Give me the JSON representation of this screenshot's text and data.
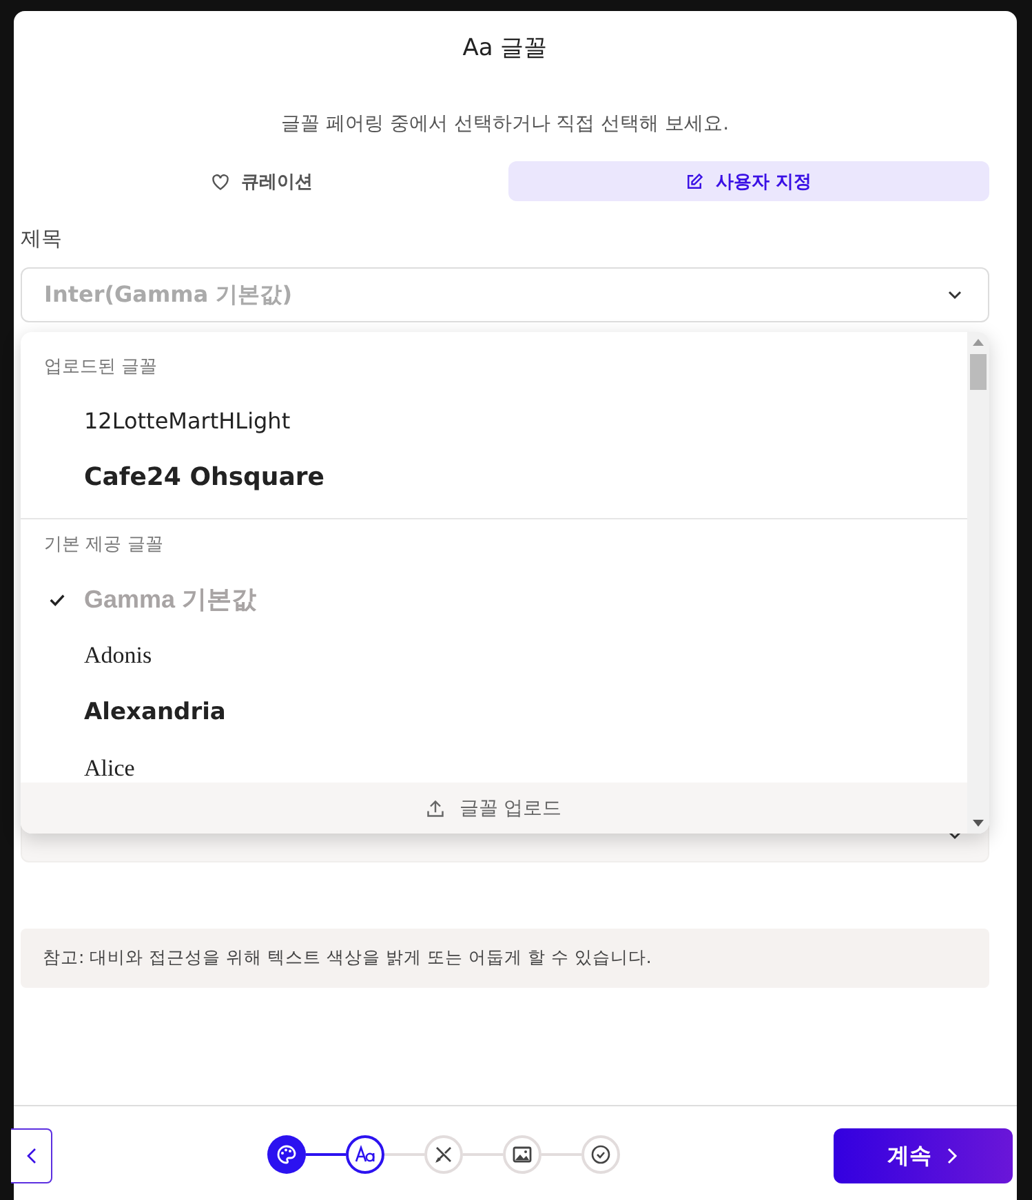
{
  "header": {
    "title": "Aa 글꼴",
    "subtitle": "글꼴 페어링 중에서 선택하거나 직접 선택해 보세요."
  },
  "tabs": [
    {
      "label": "큐레이션",
      "selected": false
    },
    {
      "label": "사용자 지정",
      "selected": true
    }
  ],
  "heading_field": {
    "label": "제목",
    "value": "Inter(Gamma 기본값)"
  },
  "dropdown": {
    "groups": [
      {
        "title": "업로드된 글꼴",
        "options": [
          {
            "label": "12LotteMartHLight",
            "kind": "rounded",
            "selected": false
          },
          {
            "label": "Cafe24 Ohsquare",
            "kind": "square",
            "selected": false
          }
        ]
      },
      {
        "title": "기본 제공 글꼴",
        "options": [
          {
            "label": "Gamma 기본값",
            "kind": "default",
            "selected": true
          },
          {
            "label": "Adonis",
            "kind": "serif",
            "selected": false
          },
          {
            "label": "Alexandria",
            "kind": "heavy",
            "selected": false
          },
          {
            "label": "Alice",
            "kind": "serif",
            "selected": false
          }
        ]
      }
    ],
    "upload_button": "글꼴 업로드"
  },
  "note": "참고: 대비와 접근성을 위해 텍스트 색상을 밝게 또는 어둡게 할 수 있습니다.",
  "steps": [
    {
      "completed": true,
      "selected": false
    },
    {
      "completed": false,
      "selected": true
    },
    {
      "completed": false,
      "selected": false
    },
    {
      "completed": false,
      "selected": false
    },
    {
      "completed": false,
      "selected": false
    }
  ],
  "continue_button": "계속"
}
